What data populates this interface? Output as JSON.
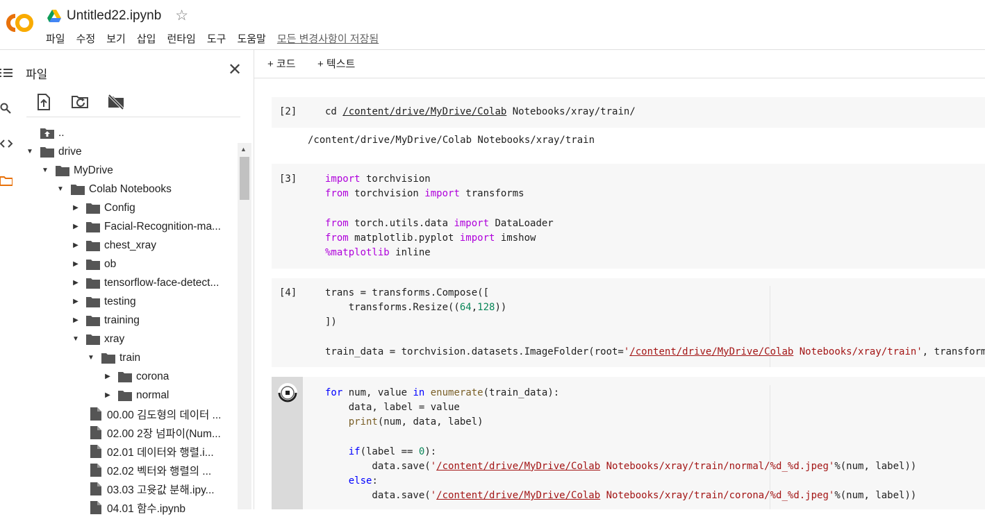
{
  "app": {
    "logo_text": "CO",
    "doc_title": "Untitled22.ipynb",
    "star_icon": "star-outline-icon",
    "menu": [
      "파일",
      "수정",
      "보기",
      "삽입",
      "런타임",
      "도구",
      "도움말"
    ],
    "save_status": "모든 변경사항이 저장됨"
  },
  "sidebar": {
    "title": "파일",
    "close": "✕",
    "tools": [
      "upload-file-icon",
      "refresh-folder-icon",
      "unmount-drive-icon"
    ],
    "tree": [
      {
        "label": "..",
        "type": "up",
        "depth": 0,
        "caret": ""
      },
      {
        "label": "drive",
        "type": "folder",
        "depth": 0,
        "caret": "▼"
      },
      {
        "label": "MyDrive",
        "type": "folder",
        "depth": 1,
        "caret": "▼"
      },
      {
        "label": "Colab Notebooks",
        "type": "folder",
        "depth": 2,
        "caret": "▼"
      },
      {
        "label": "Config",
        "type": "folder",
        "depth": 3,
        "caret": "▶"
      },
      {
        "label": "Facial-Recognition-ma...",
        "type": "folder",
        "depth": 3,
        "caret": "▶"
      },
      {
        "label": "chest_xray",
        "type": "folder",
        "depth": 3,
        "caret": "▶"
      },
      {
        "label": "ob",
        "type": "folder",
        "depth": 3,
        "caret": "▶"
      },
      {
        "label": "tensorflow-face-detect...",
        "type": "folder",
        "depth": 3,
        "caret": "▶"
      },
      {
        "label": "testing",
        "type": "folder",
        "depth": 3,
        "caret": "▶"
      },
      {
        "label": "training",
        "type": "folder",
        "depth": 3,
        "caret": "▶"
      },
      {
        "label": "xray",
        "type": "folder",
        "depth": 3,
        "caret": "▼"
      },
      {
        "label": "train",
        "type": "folder",
        "depth": 4,
        "caret": "▼"
      },
      {
        "label": "corona",
        "type": "folder",
        "depth": 5,
        "caret": "▶"
      },
      {
        "label": "normal",
        "type": "folder",
        "depth": 5,
        "caret": "▶"
      },
      {
        "label": "00.00 김도형의 데이터 ...",
        "type": "file",
        "depth": 3,
        "caret": ""
      },
      {
        "label": "02.00 2장 넘파이(Num...",
        "type": "file",
        "depth": 3,
        "caret": ""
      },
      {
        "label": "02.01 데이터와 행렬.i...",
        "type": "file",
        "depth": 3,
        "caret": ""
      },
      {
        "label": "02.02 벡터와 행렬의 ...",
        "type": "file",
        "depth": 3,
        "caret": ""
      },
      {
        "label": "03.03 고윳값 분해.ipy...",
        "type": "file",
        "depth": 3,
        "caret": ""
      },
      {
        "label": "04.01 함수.ipynb",
        "type": "file",
        "depth": 3,
        "caret": ""
      }
    ]
  },
  "toolbar": {
    "add_code": "+ 코드",
    "add_text": "+ 텍스트"
  },
  "cells": {
    "c2": {
      "prompt": "[2]",
      "cmd": "cd ",
      "path": "/content/drive/MyDrive/Colab",
      "path_rest": " Notebooks/xray/train/",
      "output": "/content/drive/MyDrive/Colab Notebooks/xray/train"
    },
    "c3": {
      "prompt": "[3]",
      "lines": [
        [
          [
            "kw",
            "import"
          ],
          [
            "",
            " torchvision"
          ]
        ],
        [
          [
            "kw",
            "from"
          ],
          [
            "",
            " torchvision "
          ],
          [
            "kw",
            "import"
          ],
          [
            "",
            " transforms"
          ]
        ],
        [
          [
            "",
            ""
          ]
        ],
        [
          [
            "kw",
            "from"
          ],
          [
            "",
            " torch.utils.data "
          ],
          [
            "kw",
            "import"
          ],
          [
            "",
            " DataLoader"
          ]
        ],
        [
          [
            "kw",
            "from"
          ],
          [
            "",
            " matplotlib.pyplot "
          ],
          [
            "kw",
            "import"
          ],
          [
            "",
            " imshow"
          ]
        ],
        [
          [
            "kw",
            "%matplotlib"
          ],
          [
            "",
            " inline"
          ]
        ]
      ]
    },
    "c4": {
      "prompt": "[4]",
      "lines": [
        [
          [
            "",
            "trans = transforms.Compose(["
          ]
        ],
        [
          [
            "",
            "    transforms.Resize(("
          ],
          [
            "num",
            "64"
          ],
          [
            "",
            ","
          ],
          [
            "num",
            "128"
          ],
          [
            "",
            "))"
          ]
        ],
        [
          [
            "",
            "])"
          ]
        ],
        [
          [
            "",
            ""
          ]
        ],
        [
          [
            "",
            "train_data = torchvision.datasets.ImageFolder(root="
          ],
          [
            "str",
            "'"
          ],
          [
            "str ul",
            "/content/drive/MyDrive/Colab"
          ],
          [
            "str",
            " Notebooks/xray/train'"
          ],
          [
            "",
            ", transform=trans)"
          ]
        ]
      ]
    },
    "c5": {
      "run_icon": "stop-running-cell-icon",
      "lines": [
        [
          [
            "blue",
            "for"
          ],
          [
            "",
            " num, value "
          ],
          [
            "blue",
            "in"
          ],
          [
            "",
            " "
          ],
          [
            "fn",
            "enumerate"
          ],
          [
            "",
            "(train_data):"
          ]
        ],
        [
          [
            "",
            "    data, label = value"
          ]
        ],
        [
          [
            "",
            "    "
          ],
          [
            "fn",
            "print"
          ],
          [
            "",
            "(num, data, label)"
          ]
        ],
        [
          [
            "",
            ""
          ]
        ],
        [
          [
            "",
            "    "
          ],
          [
            "blue",
            "if"
          ],
          [
            "",
            "(label == "
          ],
          [
            "num",
            "0"
          ],
          [
            "",
            "):"
          ]
        ],
        [
          [
            "",
            "        data.save("
          ],
          [
            "str",
            "'"
          ],
          [
            "str ul",
            "/content/drive/MyDrive/Colab"
          ],
          [
            "str",
            " Notebooks/xray/train/normal/%d_%d.jpeg'"
          ],
          [
            "",
            "%(num, label))"
          ]
        ],
        [
          [
            "",
            "    "
          ],
          [
            "blue",
            "else"
          ],
          [
            "",
            ":"
          ]
        ],
        [
          [
            "",
            "        data.save("
          ],
          [
            "str",
            "'"
          ],
          [
            "str ul",
            "/content/drive/MyDrive/Colab"
          ],
          [
            "str",
            " Notebooks/xray/train/corona/%d_%d.jpeg'"
          ],
          [
            "",
            "%(num, label))"
          ]
        ]
      ]
    }
  },
  "colors": {
    "keyword": "#af00db",
    "builtin": "#795e26",
    "control": "#0000ff",
    "number": "#098658",
    "string": "#a31515",
    "cell_bg": "#f7f7f7",
    "logo_orange": "#f9ab00"
  }
}
